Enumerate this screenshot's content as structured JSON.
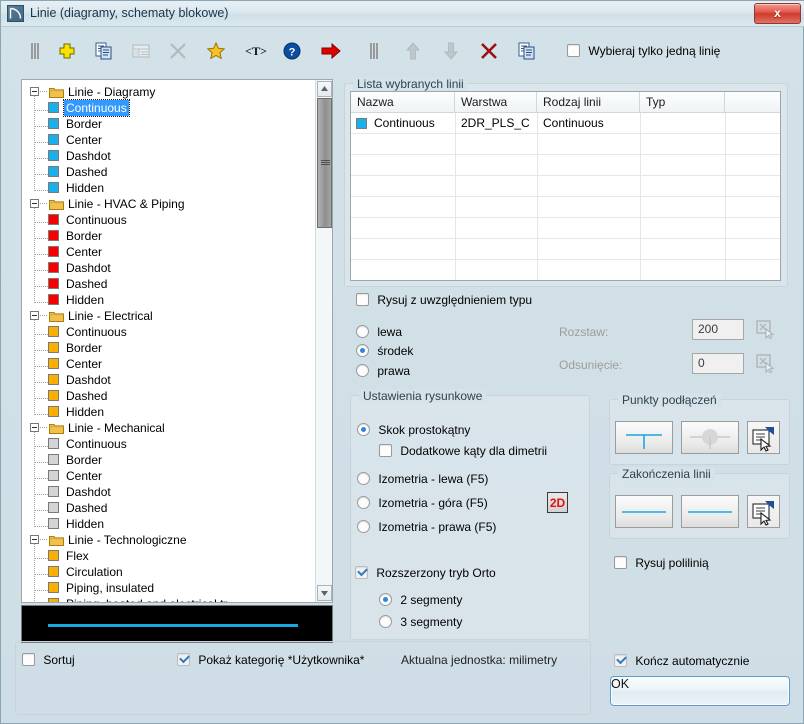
{
  "window": {
    "title": "Linie (diagramy, schematy blokowe)",
    "icon": "line-tool-icon",
    "close_label": "x",
    "accent": "#19a8e0",
    "selection_color": "#3399ff"
  },
  "toolbar": {
    "buttons": [
      {
        "name": "parallel-lines-icon",
        "label": "Linie równoległe",
        "enabled": true
      },
      {
        "name": "add-plus-icon",
        "label": "Dodaj",
        "enabled": true
      },
      {
        "name": "copy-icon",
        "label": "Kopiuj",
        "enabled": true
      },
      {
        "name": "table-properties-icon",
        "label": "Właściwości",
        "enabled": false
      },
      {
        "name": "delete-x-icon",
        "label": "Usuń",
        "enabled": false
      },
      {
        "name": "favorite-star-icon",
        "label": "Ulubione",
        "enabled": true
      },
      {
        "name": "text-tag-icon",
        "label": "<T>",
        "enabled": true
      },
      {
        "name": "help-question-icon",
        "label": "Pomoc",
        "enabled": true
      },
      {
        "name": "red-arrow-icon",
        "label": "Wstaw",
        "enabled": true
      },
      {
        "name": "parallel-lines-2-icon",
        "label": "Linie równoległe 2",
        "enabled": true
      },
      {
        "name": "move-up-icon",
        "label": "W górę",
        "enabled": false
      },
      {
        "name": "move-down-icon",
        "label": "W dół",
        "enabled": false
      },
      {
        "name": "remove-red-x-icon",
        "label": "Usuń z listy",
        "enabled": true
      },
      {
        "name": "copy-2-icon",
        "label": "Kopiuj 2",
        "enabled": true
      }
    ],
    "single_line_checkbox": {
      "label": "Wybieraj tylko jedną linię",
      "checked": false
    }
  },
  "tree": {
    "categories": [
      {
        "label": "Linie - Diagramy",
        "expanded": true,
        "color": "#1ab0ec",
        "items": [
          "Continuous",
          "Border",
          "Center",
          "Dashdot",
          "Dashed",
          "Hidden"
        ]
      },
      {
        "label": "Linie - HVAC & Piping",
        "expanded": true,
        "color": "#f70000",
        "items": [
          "Continuous",
          "Border",
          "Center",
          "Dashdot",
          "Dashed",
          "Hidden"
        ]
      },
      {
        "label": "Linie - Electrical",
        "expanded": true,
        "color": "#f9b000",
        "items": [
          "Continuous",
          "Border",
          "Center",
          "Dashdot",
          "Dashed",
          "Hidden"
        ]
      },
      {
        "label": "Linie - Mechanical",
        "expanded": true,
        "color": "#d4d4d4",
        "items": [
          "Continuous",
          "Border",
          "Center",
          "Dashdot",
          "Dashed",
          "Hidden"
        ]
      },
      {
        "label": "Linie - Technologiczne",
        "expanded": true,
        "color": "#f9b000",
        "items": [
          "Flex",
          "Circulation",
          "Piping, insulated",
          "Piping, heated and electrical tr."
        ]
      }
    ],
    "selected": "Continuous"
  },
  "preview": {
    "name": "line-preview",
    "line_color": "#19a8e0"
  },
  "selected_list": {
    "group_title": "Lista wybranych linii",
    "columns": [
      "Nazwa",
      "Warstwa",
      "Rodzaj linii",
      "Typ"
    ],
    "rows": [
      {
        "swatch": "#1ab0ec",
        "nazwa": "Continuous",
        "warstwa": "2DR_PLS_C",
        "rodzaj": "Continuous",
        "typ": ""
      }
    ]
  },
  "draw_type": {
    "label": "Rysuj z uwzględnieniem typu",
    "checked": false
  },
  "alignment": {
    "options": [
      {
        "label": "lewa",
        "selected": false
      },
      {
        "label": "środek",
        "selected": true
      },
      {
        "label": "prawa",
        "selected": false
      }
    ]
  },
  "spacing": {
    "rozstaw_label": "Rozstaw:",
    "rozstaw_value": "200",
    "odsuniecie_label": "Odsunięcie:",
    "odsuniecie_value": "0",
    "enabled": false,
    "pick_icon": "pick-from-drawing-icon"
  },
  "drawing_settings": {
    "group_title": "Ustawienia rysunkowe",
    "modes": [
      {
        "label": "Skok prostokątny",
        "selected": true
      },
      {
        "label": "Izometria - lewa (F5)",
        "selected": false
      },
      {
        "label": "Izometria - góra (F5)",
        "selected": false
      },
      {
        "label": "Izometria - prawa (F5)",
        "selected": false
      }
    ],
    "dimetry_checkbox": {
      "label": "Dodatkowe kąty dla dimetrii",
      "checked": false
    },
    "mode_badge": "2D",
    "ortho": {
      "label": "Rozszerzony tryb Orto",
      "checked": true
    },
    "segments": [
      {
        "label": "2 segmenty",
        "selected": true
      },
      {
        "label": "3 segmenty",
        "selected": false
      }
    ]
  },
  "connection_points": {
    "group_title": "Punkty podłączeń",
    "buttons": [
      {
        "name": "tee-connection-button",
        "icon": "tee-junction-icon"
      },
      {
        "name": "node-connection-button",
        "icon": "node-dot-icon"
      },
      {
        "name": "connection-settings-button",
        "icon": "properties-icon"
      }
    ]
  },
  "line_endings": {
    "group_title": "Zakończenia linii",
    "buttons": [
      {
        "name": "line-start-button",
        "icon": "plain-line-icon"
      },
      {
        "name": "line-end-button",
        "icon": "plain-line-icon"
      },
      {
        "name": "endings-settings-button",
        "icon": "properties-icon"
      }
    ]
  },
  "polyline": {
    "label": "Rysuj polilinią",
    "checked": false
  },
  "bottom": {
    "sort": {
      "label": "Sortuj",
      "checked": false
    },
    "show_user_category": {
      "label": "Pokaż kategorię *Użytkownika*",
      "checked": true
    },
    "unit_text": "Aktualna jednostka: milimetry",
    "auto_finish": {
      "label": "Kończ automatycznie",
      "checked": true
    },
    "ok_label": "OK"
  }
}
